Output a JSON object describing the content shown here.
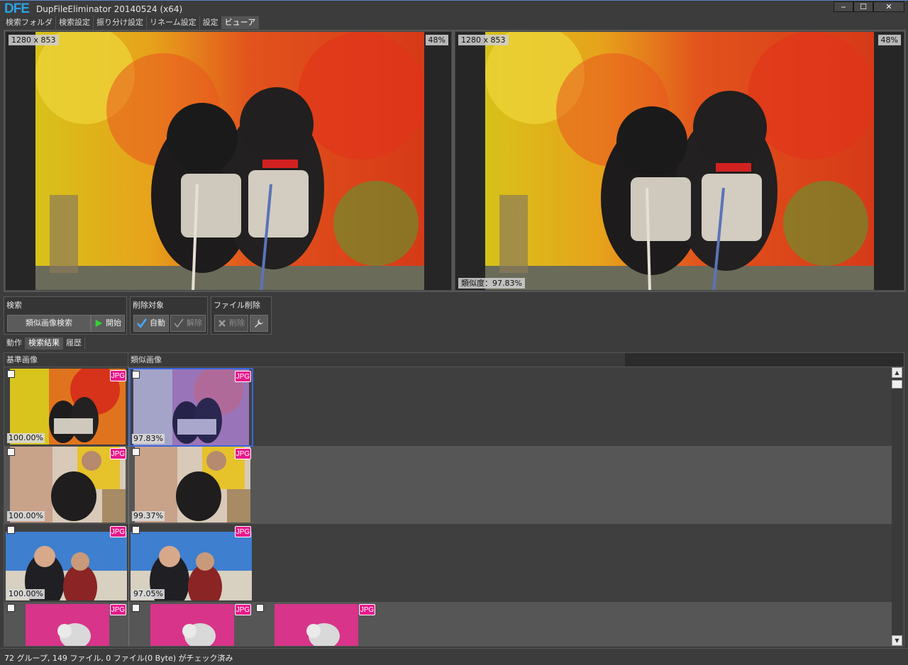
{
  "window": {
    "logo": "DFE",
    "title": "DupFileEliminator 20140524 (x64)",
    "controls": {
      "minimize": "‒",
      "maximize": "☐",
      "close": "✕"
    }
  },
  "tabs": [
    "検索フォルダ",
    "検索設定",
    "振り分け設定",
    "リネーム設定",
    "設定",
    "ビューア"
  ],
  "viewer": {
    "left": {
      "dimensions": "1280 x 853",
      "zoom": "48%"
    },
    "right": {
      "dimensions": "1280 x 853",
      "zoom": "48%",
      "similarity": "類似度：97.83%"
    }
  },
  "toolbar": {
    "search": {
      "label": "検索",
      "similar_button": "類似画像検索",
      "start_button": "開始"
    },
    "delete_target": {
      "label": "削除対象",
      "auto_button": "自動",
      "release_button": "解除"
    },
    "file_delete": {
      "label": "ファイル削除",
      "delete_button": "削除"
    }
  },
  "subtabs": [
    "動作",
    "検索結果",
    "履歴"
  ],
  "results": {
    "col_base": "基準画像",
    "col_similar": "類似画像",
    "badge": "JPG",
    "rows": [
      {
        "base_pct": "100.00%",
        "similar_pct": "97.83%"
      },
      {
        "base_pct": "100.00%",
        "similar_pct": "99.37%"
      },
      {
        "base_pct": "100.00%",
        "similar_pct": "97.05%"
      }
    ]
  },
  "status": "72 グループ, 149 ファイル, 0 ファイル(0 Byte) がチェック済み",
  "colors": {
    "accent": "#2aa2e8",
    "badge": "#e8198b",
    "selection": "#3a66dd"
  }
}
